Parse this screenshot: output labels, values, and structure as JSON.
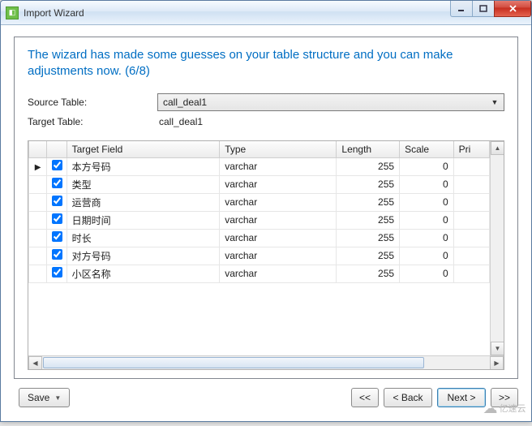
{
  "window": {
    "title": "Import Wizard"
  },
  "heading": "The wizard has made some guesses on your table structure and you can make adjustments now. (6/8)",
  "labels": {
    "source_table": "Source Table:",
    "target_table": "Target Table:"
  },
  "source_table_value": "call_deal1",
  "target_table_value": "call_deal1",
  "columns": {
    "target_field": "Target Field",
    "type": "Type",
    "length": "Length",
    "scale": "Scale",
    "pri": "Pri"
  },
  "rows": [
    {
      "checked": true,
      "current": true,
      "field": "本方号码",
      "type": "varchar",
      "length": 255,
      "scale": 0
    },
    {
      "checked": true,
      "current": false,
      "field": "类型",
      "type": "varchar",
      "length": 255,
      "scale": 0
    },
    {
      "checked": true,
      "current": false,
      "field": "运营商",
      "type": "varchar",
      "length": 255,
      "scale": 0
    },
    {
      "checked": true,
      "current": false,
      "field": "日期时间",
      "type": "varchar",
      "length": 255,
      "scale": 0
    },
    {
      "checked": true,
      "current": false,
      "field": "时长",
      "type": "varchar",
      "length": 255,
      "scale": 0
    },
    {
      "checked": true,
      "current": false,
      "field": "对方号码",
      "type": "varchar",
      "length": 255,
      "scale": 0
    },
    {
      "checked": true,
      "current": false,
      "field": "小区名称",
      "type": "varchar",
      "length": 255,
      "scale": 0
    }
  ],
  "buttons": {
    "save": "Save",
    "first": "<<",
    "back": "< Back",
    "next": "Next >",
    "last": ">>"
  },
  "watermark_logo": "亿速云"
}
